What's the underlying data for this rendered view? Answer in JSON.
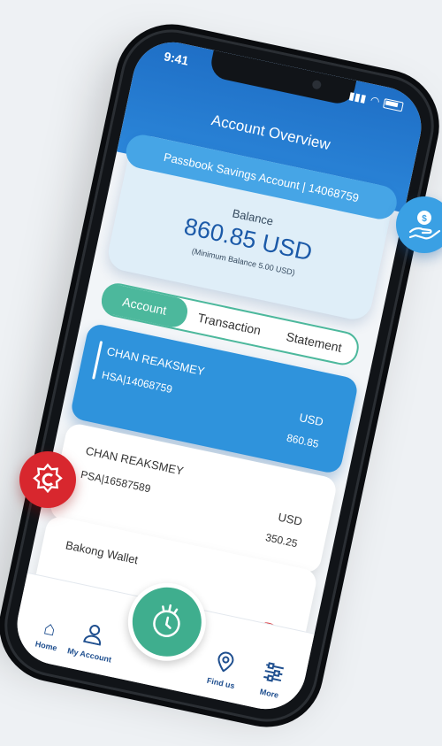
{
  "status_bar": {
    "time": "9:41"
  },
  "header": {
    "title": "Account Overview"
  },
  "balance_card": {
    "account_label": "Passbook Savings Account  | 14068759",
    "balance_label": "Balance",
    "balance_value": "860.85 USD",
    "minimum_note": "(Minimum Balance  5.00 USD)"
  },
  "tabs": [
    "Account",
    "Transaction",
    "Statement"
  ],
  "accounts": [
    {
      "name": "CHAN REAKSMEY",
      "number": "HSA|14068759",
      "currency": "USD",
      "amount": "860.85"
    },
    {
      "name": "CHAN REAKSMEY",
      "number": "PSA|16587589",
      "currency": "USD",
      "amount": "350.25"
    }
  ],
  "wallet": {
    "name": "Bakong Wallet"
  },
  "nav": {
    "home": "Home",
    "my_account": "My Account",
    "find_us": "Find us",
    "more": "More"
  },
  "colors": {
    "header_blue": "#2b86d9",
    "selected_card": "#2f93dc",
    "tab_green": "#4cb89c",
    "fab_green": "#3fae8e",
    "badge_red": "#d8272e"
  },
  "icons": {
    "money_hand": "money-hand-icon",
    "bakong_badge": "bakong-badge-icon",
    "home": "home-icon",
    "my_account": "user-icon",
    "find_us": "location-pin-icon",
    "more": "sliders-icon",
    "fab": "tap-hand-icon"
  }
}
